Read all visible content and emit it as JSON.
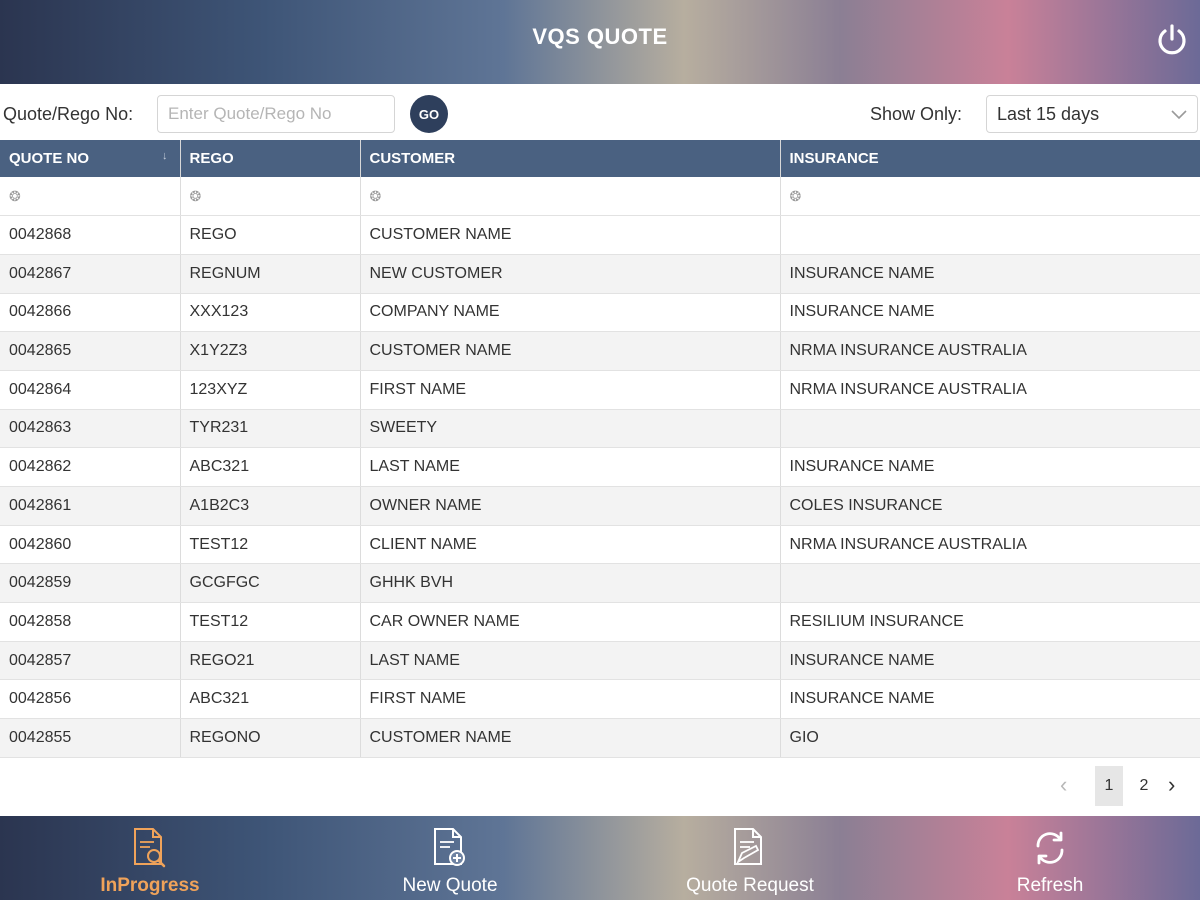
{
  "header": {
    "title": "VQS QUOTE",
    "power_icon": "power-icon"
  },
  "search": {
    "label": "Quote/Rego No:",
    "value": "",
    "placeholder": "Enter Quote/Rego No",
    "go_label": "GO",
    "show_only_label": "Show Only:",
    "show_only_selected": "Last 15 days"
  },
  "table": {
    "columns": [
      "QUOTE NO",
      "REGO",
      "CUSTOMER",
      "INSURANCE"
    ],
    "sort_indicator": "↓",
    "rows": [
      [
        "0042868",
        "REGO",
        "CUSTOMER NAME",
        ""
      ],
      [
        "0042867",
        "REGNUM",
        "NEW CUSTOMER",
        "INSURANCE NAME"
      ],
      [
        "0042866",
        "XXX123",
        "COMPANY NAME",
        "INSURANCE NAME"
      ],
      [
        "0042865",
        "X1Y2Z3",
        "CUSTOMER NAME",
        "NRMA INSURANCE AUSTRALIA"
      ],
      [
        "0042864",
        "123XYZ",
        "FIRST NAME",
        "NRMA INSURANCE AUSTRALIA"
      ],
      [
        "0042863",
        "TYR231",
        "SWEETY",
        ""
      ],
      [
        "0042862",
        "ABC321",
        "LAST NAME",
        "INSURANCE NAME"
      ],
      [
        "0042861",
        "A1B2C3",
        "OWNER NAME",
        "COLES INSURANCE"
      ],
      [
        "0042860",
        "TEST12",
        "CLIENT NAME",
        "NRMA INSURANCE AUSTRALIA"
      ],
      [
        "0042859",
        "GCGFGC",
        "GHHK BVH",
        ""
      ],
      [
        "0042858",
        "TEST12",
        "CAR OWNER NAME",
        "RESILIUM INSURANCE"
      ],
      [
        "0042857",
        "REGO21",
        "LAST NAME",
        "INSURANCE NAME"
      ],
      [
        "0042856",
        "ABC321",
        "FIRST NAME",
        "INSURANCE NAME"
      ],
      [
        "0042855",
        "REGONO",
        "CUSTOMER NAME",
        "GIO"
      ]
    ]
  },
  "pagination": {
    "current": "1",
    "pages": [
      "1",
      "2"
    ]
  },
  "bottom_nav": [
    {
      "label": "InProgress",
      "icon": "inprogress-document-search-icon",
      "active": true
    },
    {
      "label": "New Quote",
      "icon": "new-quote-document-add-icon",
      "active": false
    },
    {
      "label": "Quote Request",
      "icon": "quote-request-document-edit-icon",
      "active": false
    },
    {
      "label": "Refresh",
      "icon": "refresh-icon",
      "active": false
    }
  ],
  "colors": {
    "header_gradient_start": "#2b3550",
    "table_header": "#4a6181",
    "go_button": "#2e3f5c",
    "active_tab": "#f0a35a"
  }
}
